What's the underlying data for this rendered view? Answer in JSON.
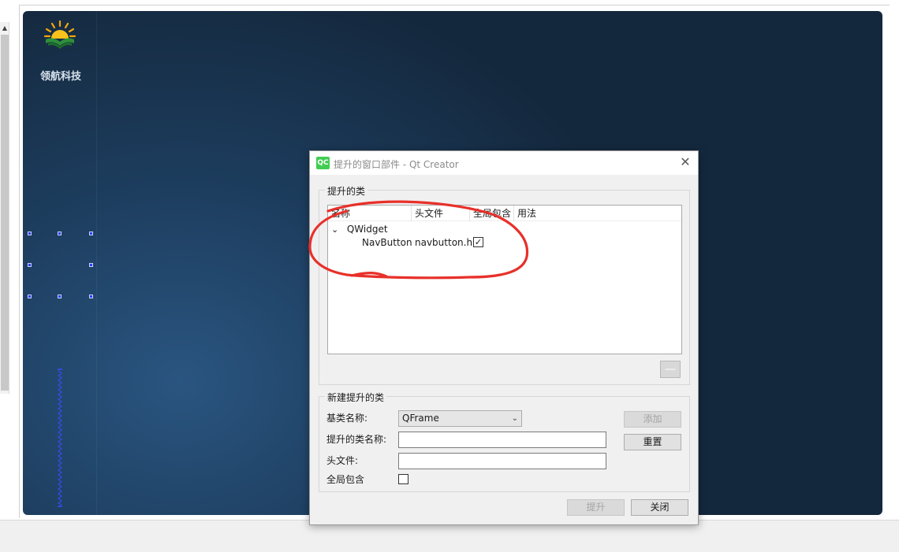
{
  "designer": {
    "brand_text": "领航科技"
  },
  "dialog": {
    "app_icon_text": "QC",
    "title": "提升的窗口部件 - Qt Creator",
    "close_glyph": "✕",
    "promoted_group": {
      "title": "提升的类",
      "columns": [
        "名称",
        "头文件",
        "全局包含",
        "用法"
      ],
      "tree": {
        "parent": {
          "expander": "⌄",
          "name": "QWidget"
        },
        "children": [
          {
            "name": "NavButton",
            "header": "navbutton.h",
            "global_include": "✓",
            "usage": ""
          }
        ]
      },
      "remove_glyph": "—"
    },
    "new_group": {
      "title": "新建提升的类",
      "base_class_label": "基类名称:",
      "base_class_value": "QFrame",
      "combo_arrow": "⌄",
      "promoted_class_label": "提升的类名称:",
      "promoted_class_value": "",
      "header_label": "头文件:",
      "header_value": "",
      "global_include_label": "全局包含",
      "global_include_checked": "",
      "add_label": "添加",
      "reset_label": "重置"
    },
    "promote_label": "提升",
    "close_label": "关闭"
  },
  "annotation": {
    "color": "#e8302a"
  }
}
